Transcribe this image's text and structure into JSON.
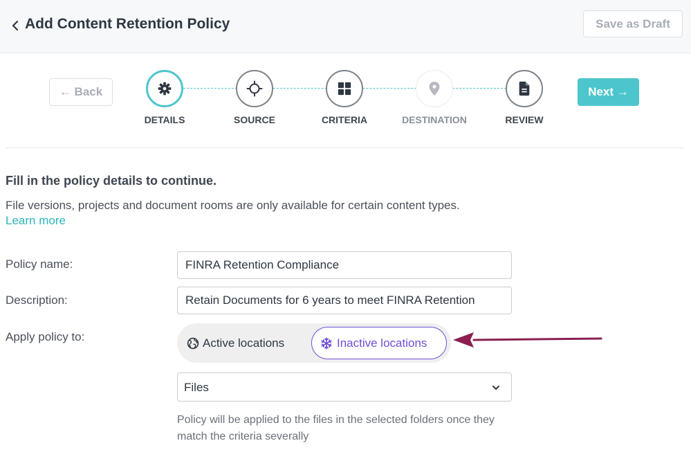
{
  "header": {
    "title": "Add Content Retention Policy",
    "save_draft_label": "Save as Draft",
    "back_icon": "chevron-left-icon"
  },
  "wizard": {
    "back_label": "← Back",
    "next_label": "Next →",
    "accent_color": "#4cc6cc",
    "steps": [
      {
        "label": "DETAILS",
        "icon": "gear-icon",
        "state": "active"
      },
      {
        "label": "SOURCE",
        "icon": "crosshair-icon",
        "state": "enabled"
      },
      {
        "label": "CRITERIA",
        "icon": "grid-icon",
        "state": "enabled"
      },
      {
        "label": "DESTINATION",
        "icon": "location-pin-icon",
        "state": "disabled"
      },
      {
        "label": "REVIEW",
        "icon": "document-icon",
        "state": "enabled"
      }
    ]
  },
  "section": {
    "title": "Fill in the policy details to continue.",
    "description": "File versions, projects and document rooms are only available for certain content types.",
    "learn_more": "Learn more"
  },
  "form": {
    "policy_name_label": "Policy name:",
    "policy_name_value": "FINRA Retention Compliance",
    "description_label": "Description:",
    "description_value": "Retain Documents for 6 years to meet FINRA Retention",
    "apply_label": "Apply policy to:",
    "location_toggle": {
      "active_label": "Active locations",
      "inactive_label": "Inactive locations",
      "selected": "Inactive locations",
      "selected_color": "#6e4fd6"
    },
    "content_type_value": "Files",
    "help_text": "Policy will be applied to the files in the selected folders once they match the criteria severally"
  },
  "annotation": {
    "arrow_color": "#8b1f4f"
  }
}
